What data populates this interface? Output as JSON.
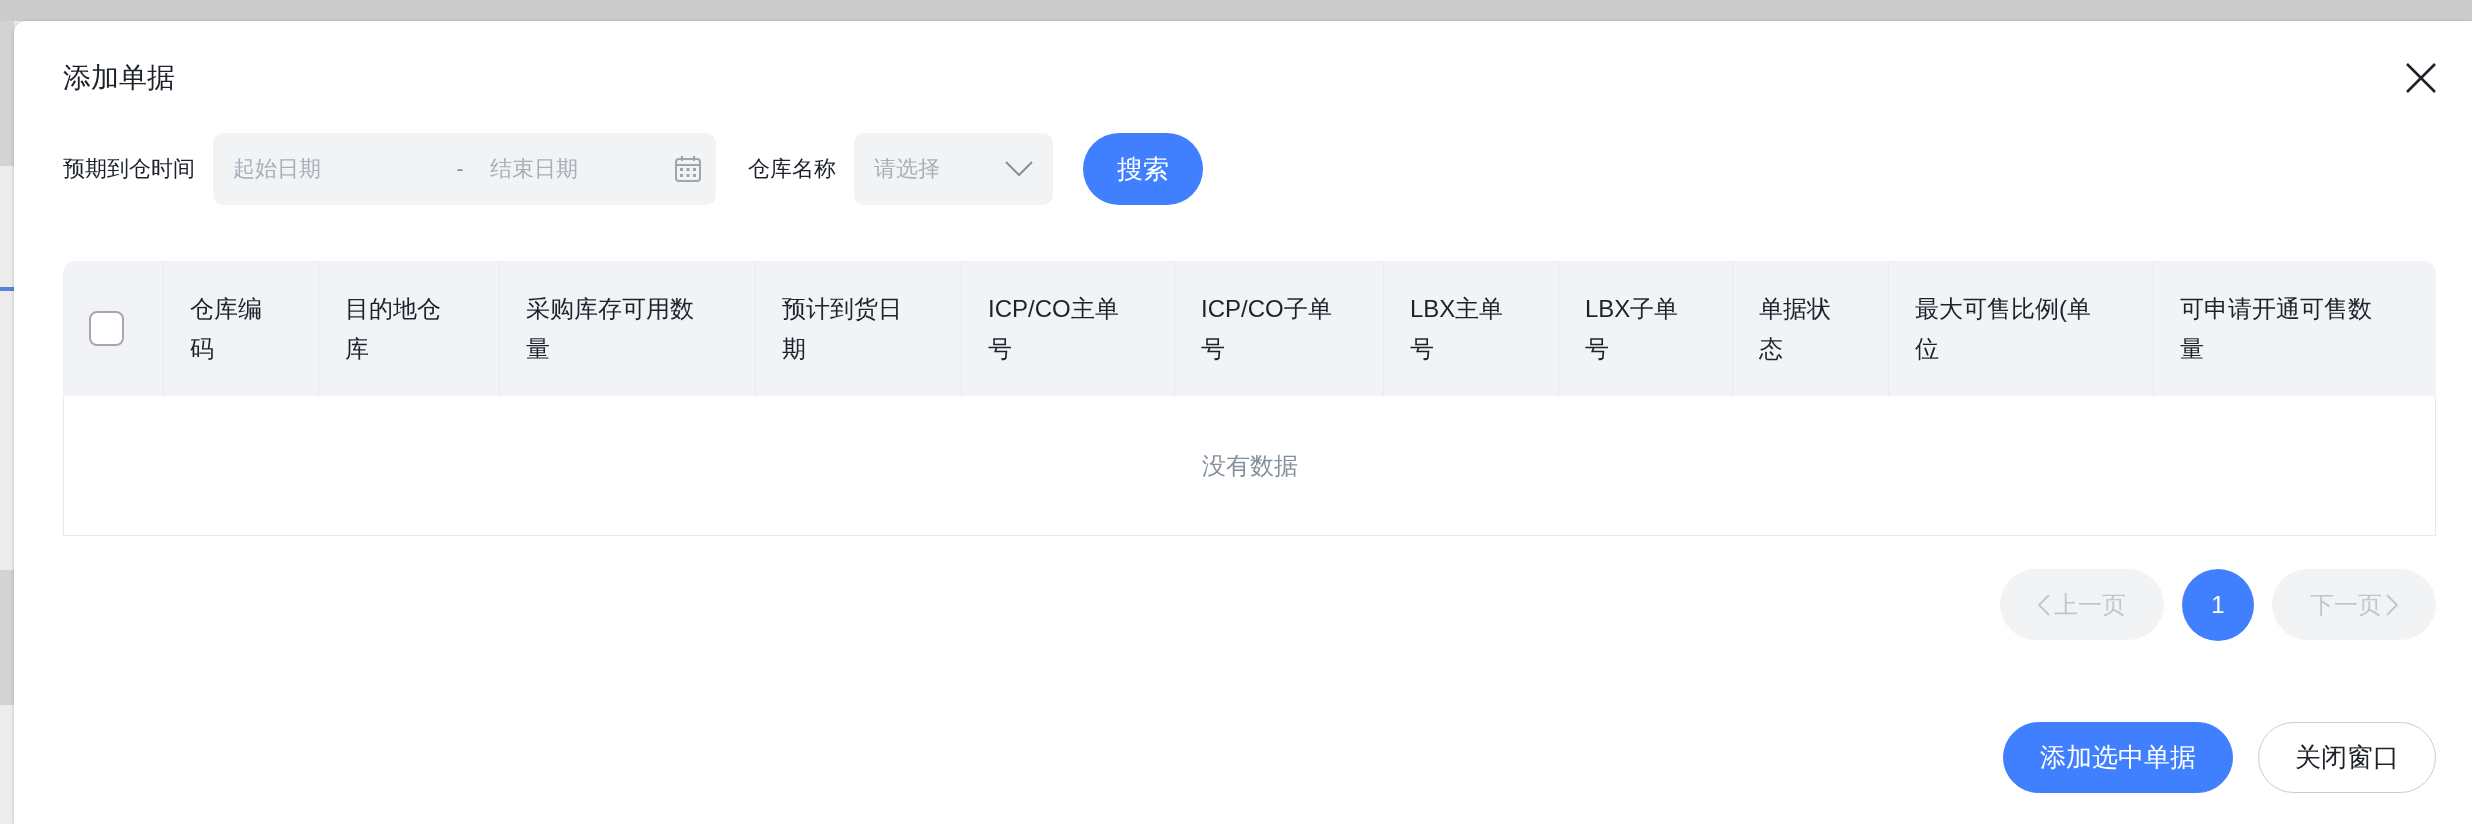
{
  "dialog": {
    "title": "添加单据"
  },
  "filters": {
    "arrival_time": {
      "label": "预期到仓时间",
      "start_placeholder": "起始日期",
      "separator": "-",
      "end_placeholder": "结束日期"
    },
    "warehouse": {
      "label": "仓库名称",
      "placeholder": "请选择"
    },
    "search_button": "搜索"
  },
  "table": {
    "select_all": {
      "checked": false
    },
    "columns": [
      "仓库编码",
      "目的地仓库",
      "采购库存可用数量",
      "预计到货日期",
      "ICP/CO主单号",
      "ICP/CO子单号",
      "LBX主单号",
      "LBX子单号",
      "单据状态",
      "最大可售比例(单位",
      "可申请开通可售数量"
    ],
    "empty_text": "没有数据"
  },
  "pagination": {
    "prev": {
      "label": "上一页",
      "disabled": true
    },
    "pages": [
      {
        "label": "1",
        "selected": true
      }
    ],
    "next": {
      "label": "下一页",
      "disabled": true
    }
  },
  "actions": [
    {
      "label": "添加选中单据",
      "kind": "primary"
    },
    {
      "label": "关闭窗口",
      "kind": "secondary"
    }
  ]
}
